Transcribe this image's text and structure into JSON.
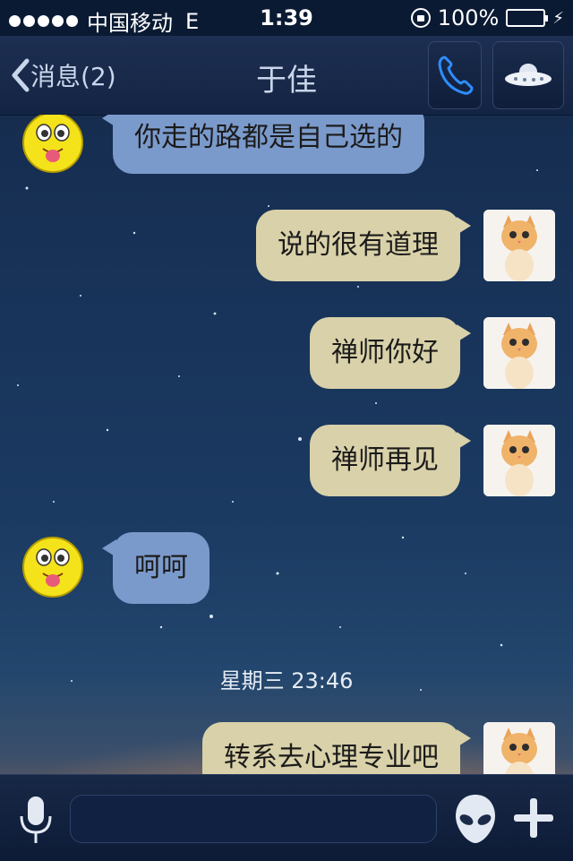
{
  "status_bar": {
    "carrier": "中国移动",
    "network": "E",
    "time": "1:39",
    "battery": "100%",
    "battery_level": 1.0
  },
  "nav": {
    "back_label": "消息(2)",
    "title": "于佳"
  },
  "messages": [
    {
      "side": "left",
      "text": "你走的路都是自己选的",
      "avatar": "smiley-icon"
    },
    {
      "side": "right",
      "text": "说的很有道理",
      "avatar": "cat-avatar"
    },
    {
      "side": "right",
      "text": "禅师你好",
      "avatar": "cat-avatar"
    },
    {
      "side": "right",
      "text": "禅师再见",
      "avatar": "cat-avatar"
    },
    {
      "side": "left",
      "text": "呵呵",
      "avatar": "smiley-icon"
    },
    {
      "type": "timestamp",
      "text": "星期三 23:46"
    },
    {
      "side": "right",
      "text": "转系去心理专业吧",
      "avatar": "cat-avatar"
    }
  ],
  "input": {
    "value": "",
    "placeholder": ""
  },
  "colors": {
    "bubble_left": "#7b9acc",
    "bubble_right": "#d9d1a9",
    "battery": "#5fe04a"
  }
}
